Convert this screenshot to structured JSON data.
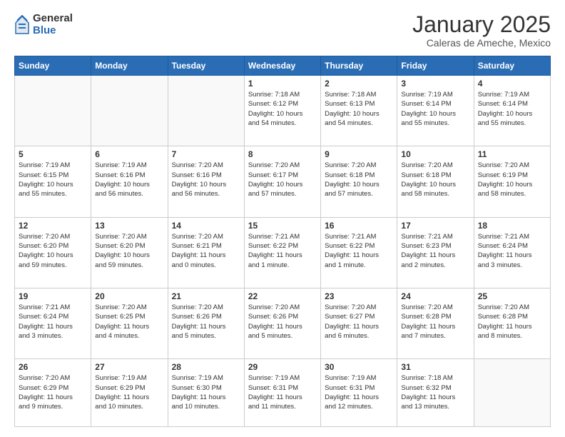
{
  "header": {
    "logo": {
      "general": "General",
      "blue": "Blue"
    },
    "title": "January 2025",
    "subtitle": "Caleras de Ameche, Mexico"
  },
  "days_of_week": [
    "Sunday",
    "Monday",
    "Tuesday",
    "Wednesday",
    "Thursday",
    "Friday",
    "Saturday"
  ],
  "weeks": [
    [
      {
        "day": "",
        "info": ""
      },
      {
        "day": "",
        "info": ""
      },
      {
        "day": "",
        "info": ""
      },
      {
        "day": "1",
        "info": "Sunrise: 7:18 AM\nSunset: 6:12 PM\nDaylight: 10 hours\nand 54 minutes."
      },
      {
        "day": "2",
        "info": "Sunrise: 7:18 AM\nSunset: 6:13 PM\nDaylight: 10 hours\nand 54 minutes."
      },
      {
        "day": "3",
        "info": "Sunrise: 7:19 AM\nSunset: 6:14 PM\nDaylight: 10 hours\nand 55 minutes."
      },
      {
        "day": "4",
        "info": "Sunrise: 7:19 AM\nSunset: 6:14 PM\nDaylight: 10 hours\nand 55 minutes."
      }
    ],
    [
      {
        "day": "5",
        "info": "Sunrise: 7:19 AM\nSunset: 6:15 PM\nDaylight: 10 hours\nand 55 minutes."
      },
      {
        "day": "6",
        "info": "Sunrise: 7:19 AM\nSunset: 6:16 PM\nDaylight: 10 hours\nand 56 minutes."
      },
      {
        "day": "7",
        "info": "Sunrise: 7:20 AM\nSunset: 6:16 PM\nDaylight: 10 hours\nand 56 minutes."
      },
      {
        "day": "8",
        "info": "Sunrise: 7:20 AM\nSunset: 6:17 PM\nDaylight: 10 hours\nand 57 minutes."
      },
      {
        "day": "9",
        "info": "Sunrise: 7:20 AM\nSunset: 6:18 PM\nDaylight: 10 hours\nand 57 minutes."
      },
      {
        "day": "10",
        "info": "Sunrise: 7:20 AM\nSunset: 6:18 PM\nDaylight: 10 hours\nand 58 minutes."
      },
      {
        "day": "11",
        "info": "Sunrise: 7:20 AM\nSunset: 6:19 PM\nDaylight: 10 hours\nand 58 minutes."
      }
    ],
    [
      {
        "day": "12",
        "info": "Sunrise: 7:20 AM\nSunset: 6:20 PM\nDaylight: 10 hours\nand 59 minutes."
      },
      {
        "day": "13",
        "info": "Sunrise: 7:20 AM\nSunset: 6:20 PM\nDaylight: 10 hours\nand 59 minutes."
      },
      {
        "day": "14",
        "info": "Sunrise: 7:20 AM\nSunset: 6:21 PM\nDaylight: 11 hours\nand 0 minutes."
      },
      {
        "day": "15",
        "info": "Sunrise: 7:21 AM\nSunset: 6:22 PM\nDaylight: 11 hours\nand 1 minute."
      },
      {
        "day": "16",
        "info": "Sunrise: 7:21 AM\nSunset: 6:22 PM\nDaylight: 11 hours\nand 1 minute."
      },
      {
        "day": "17",
        "info": "Sunrise: 7:21 AM\nSunset: 6:23 PM\nDaylight: 11 hours\nand 2 minutes."
      },
      {
        "day": "18",
        "info": "Sunrise: 7:21 AM\nSunset: 6:24 PM\nDaylight: 11 hours\nand 3 minutes."
      }
    ],
    [
      {
        "day": "19",
        "info": "Sunrise: 7:21 AM\nSunset: 6:24 PM\nDaylight: 11 hours\nand 3 minutes."
      },
      {
        "day": "20",
        "info": "Sunrise: 7:20 AM\nSunset: 6:25 PM\nDaylight: 11 hours\nand 4 minutes."
      },
      {
        "day": "21",
        "info": "Sunrise: 7:20 AM\nSunset: 6:26 PM\nDaylight: 11 hours\nand 5 minutes."
      },
      {
        "day": "22",
        "info": "Sunrise: 7:20 AM\nSunset: 6:26 PM\nDaylight: 11 hours\nand 5 minutes."
      },
      {
        "day": "23",
        "info": "Sunrise: 7:20 AM\nSunset: 6:27 PM\nDaylight: 11 hours\nand 6 minutes."
      },
      {
        "day": "24",
        "info": "Sunrise: 7:20 AM\nSunset: 6:28 PM\nDaylight: 11 hours\nand 7 minutes."
      },
      {
        "day": "25",
        "info": "Sunrise: 7:20 AM\nSunset: 6:28 PM\nDaylight: 11 hours\nand 8 minutes."
      }
    ],
    [
      {
        "day": "26",
        "info": "Sunrise: 7:20 AM\nSunset: 6:29 PM\nDaylight: 11 hours\nand 9 minutes."
      },
      {
        "day": "27",
        "info": "Sunrise: 7:19 AM\nSunset: 6:29 PM\nDaylight: 11 hours\nand 10 minutes."
      },
      {
        "day": "28",
        "info": "Sunrise: 7:19 AM\nSunset: 6:30 PM\nDaylight: 11 hours\nand 10 minutes."
      },
      {
        "day": "29",
        "info": "Sunrise: 7:19 AM\nSunset: 6:31 PM\nDaylight: 11 hours\nand 11 minutes."
      },
      {
        "day": "30",
        "info": "Sunrise: 7:19 AM\nSunset: 6:31 PM\nDaylight: 11 hours\nand 12 minutes."
      },
      {
        "day": "31",
        "info": "Sunrise: 7:18 AM\nSunset: 6:32 PM\nDaylight: 11 hours\nand 13 minutes."
      },
      {
        "day": "",
        "info": ""
      }
    ]
  ]
}
